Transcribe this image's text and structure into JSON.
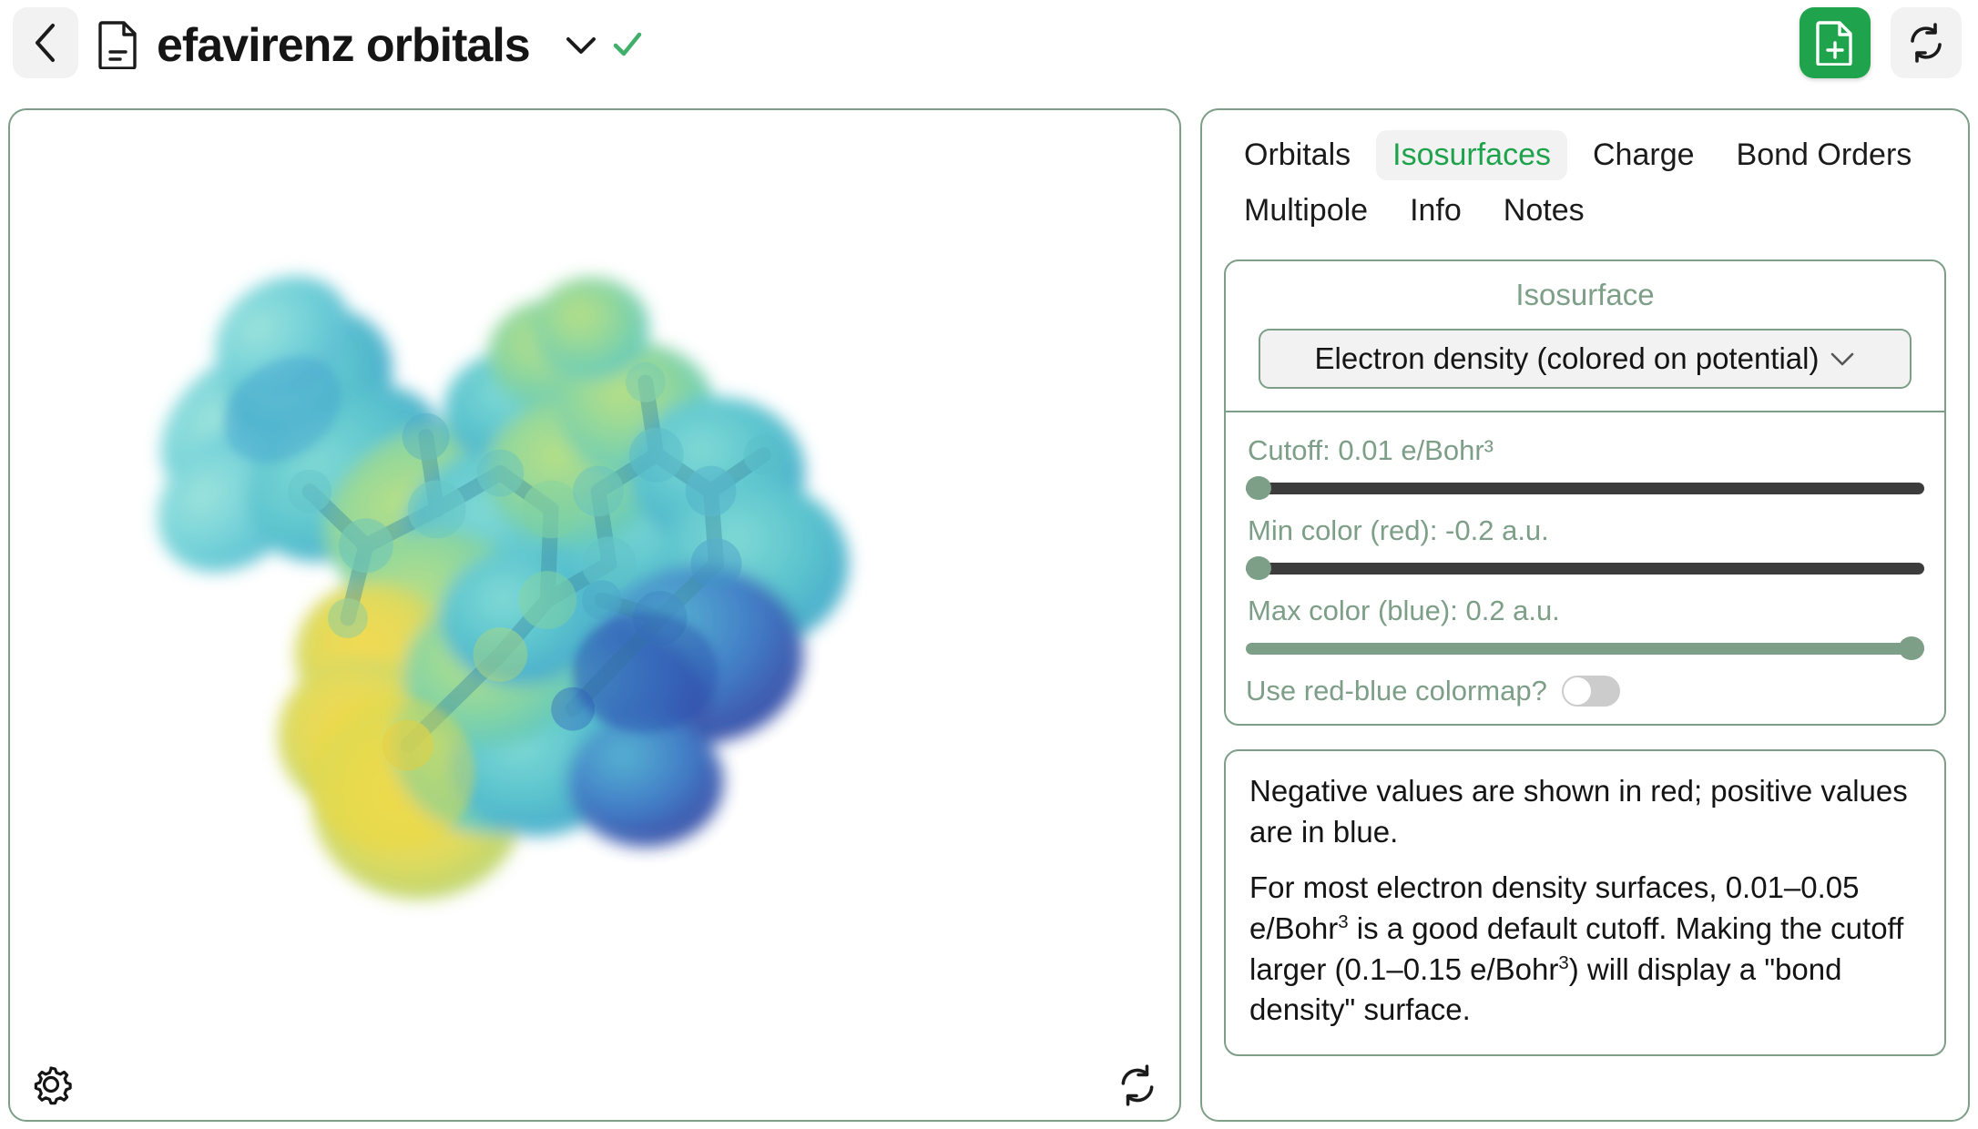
{
  "header": {
    "back_icon": "chevron-left-icon",
    "doc_icon": "document-icon",
    "title": "efavirenz orbitals",
    "title_chevron_icon": "chevron-down-icon",
    "saved_check_icon": "check-icon",
    "new_file_label": "new-file",
    "refresh_label": "refresh",
    "accent_green": "#1fa34c"
  },
  "viewer": {
    "settings_icon": "gear-icon",
    "refresh_icon": "refresh-icon",
    "border_color": "#7d9e87"
  },
  "tabs": [
    {
      "label": "Orbitals",
      "active": false
    },
    {
      "label": "Isosurfaces",
      "active": true
    },
    {
      "label": "Charge",
      "active": false
    },
    {
      "label": "Bond Orders",
      "active": false
    },
    {
      "label": "Multipole",
      "active": false
    },
    {
      "label": "Info",
      "active": false
    },
    {
      "label": "Notes",
      "active": false
    }
  ],
  "isosurface": {
    "heading": "Isosurface",
    "selected_option": "Electron density (colored on potential)",
    "dropdown_icon": "chevron-down-icon",
    "controls": [
      {
        "label": "Cutoff: 0.01 e/Bohr³",
        "value": 0,
        "position": "left"
      },
      {
        "label": "Min color (red): -0.2 a.u.",
        "value": 0,
        "position": "left"
      },
      {
        "label": "Max color (blue): 0.2 a.u.",
        "value": 100,
        "position": "right"
      }
    ],
    "toggle_label": "Use red-blue colormap?",
    "toggle_on": false
  },
  "info": {
    "paragraph_1": "Negative values are shown in red; positive values are in blue.",
    "paragraph_2_a": "For most electron density surfaces, 0.01–0.05 e/Bohr",
    "paragraph_2_sup_a": "3",
    "paragraph_2_b": " is a good default cutoff. Making the cutoff larger (0.1–0.15 e/Bohr",
    "paragraph_2_sup_b": "3",
    "paragraph_2_c": ") will display a \"bond density\" surface."
  },
  "molecule": {
    "render_type": "electron-density-isosurface-colored-on-electrostatic-potential",
    "colormap": "viridis",
    "colormap_low": "#2b3d8f",
    "colormap_mid": "#35b3c0",
    "colormap_high": "#e8d940"
  }
}
